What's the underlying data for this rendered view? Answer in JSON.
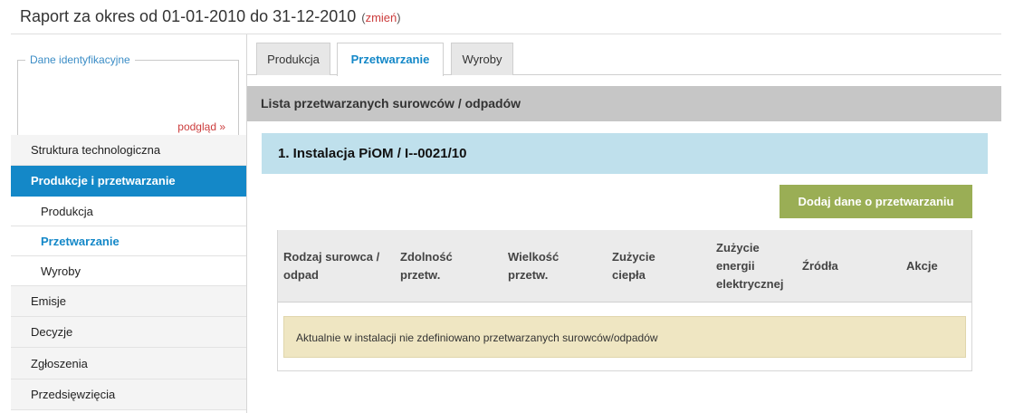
{
  "header": {
    "title": "Raport za okres od 01-01-2010 do 31-12-2010",
    "change_open": "(",
    "change_link": "zmień",
    "change_close": ")"
  },
  "sidebar": {
    "fieldset_legend": "Dane identyfikacyjne",
    "fieldset_link": "podgląd »",
    "menu": [
      {
        "label": "Struktura technologiczna"
      },
      {
        "label": "Produkcje i przetwarzanie"
      },
      {
        "label": "Produkcja"
      },
      {
        "label": "Przetwarzanie"
      },
      {
        "label": "Wyroby"
      },
      {
        "label": "Emisje"
      },
      {
        "label": "Decyzje"
      },
      {
        "label": "Zgłoszenia"
      },
      {
        "label": "Przedsięwzięcia"
      }
    ]
  },
  "tabs": [
    {
      "label": "Produkcja"
    },
    {
      "label": "Przetwarzanie"
    },
    {
      "label": "Wyroby"
    }
  ],
  "section": {
    "title": "Lista przetwarzanych surowców / odpadów"
  },
  "installation": {
    "title": "1. Instalacja PiOM / I--0021/10",
    "add_button": "Dodaj dane o przetwarzaniu"
  },
  "table": {
    "columns": [
      [
        "Rodzaj surowca /",
        "odpad"
      ],
      [
        "Zdolność",
        "przetw."
      ],
      [
        "Wielkość",
        "przetw."
      ],
      [
        "Zużycie",
        "ciepła"
      ],
      [
        "Zużycie",
        "energii",
        "elektrycznej"
      ],
      [
        "Źródła"
      ],
      [
        "Akcje"
      ]
    ],
    "empty_message": "Aktualnie w instalacji nie zdefiniowano przetwarzanych surowców/odpadów"
  }
}
